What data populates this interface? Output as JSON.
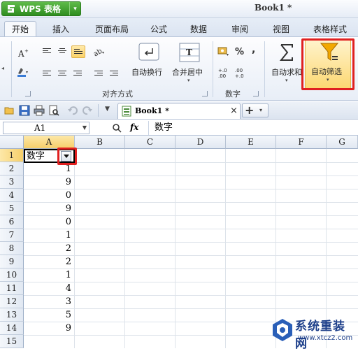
{
  "titlebar": {
    "app_button": "WPS 表格",
    "document_title": "Book1 *"
  },
  "tabs": [
    "开始",
    "插入",
    "页面布局",
    "公式",
    "数据",
    "审阅",
    "视图",
    "表格样式"
  ],
  "ribbon": {
    "buttons": {
      "wrap_text": "自动换行",
      "merge_center": "合并居中",
      "autosum": "自动求和",
      "autofilter": "自动筛选",
      "percent": "%",
      "comma": ","
    },
    "groups": {
      "alignment": "对齐方式",
      "number": "数字"
    }
  },
  "quickbar": {
    "doc_tab": "Book1 *"
  },
  "formula_bar": {
    "name_box": "A1",
    "fx": "fx",
    "content": "数字"
  },
  "grid": {
    "columns": [
      "A",
      "B",
      "C",
      "D",
      "E",
      "F",
      "G"
    ],
    "rows": [
      "1",
      "2",
      "3",
      "4",
      "5",
      "6",
      "7",
      "8",
      "9",
      "10",
      "11",
      "12",
      "13",
      "14",
      "15"
    ],
    "a1_value": "数字",
    "a_values": [
      "1",
      "9",
      "0",
      "9",
      "0",
      "1",
      "2",
      "2",
      "1",
      "4",
      "3",
      "5",
      "9"
    ]
  },
  "watermark": {
    "title": "系统重装网",
    "url": "www.xtcz2.com"
  },
  "colors": {
    "highlight": "#e02020",
    "wps_green": "#3a9a2a"
  }
}
